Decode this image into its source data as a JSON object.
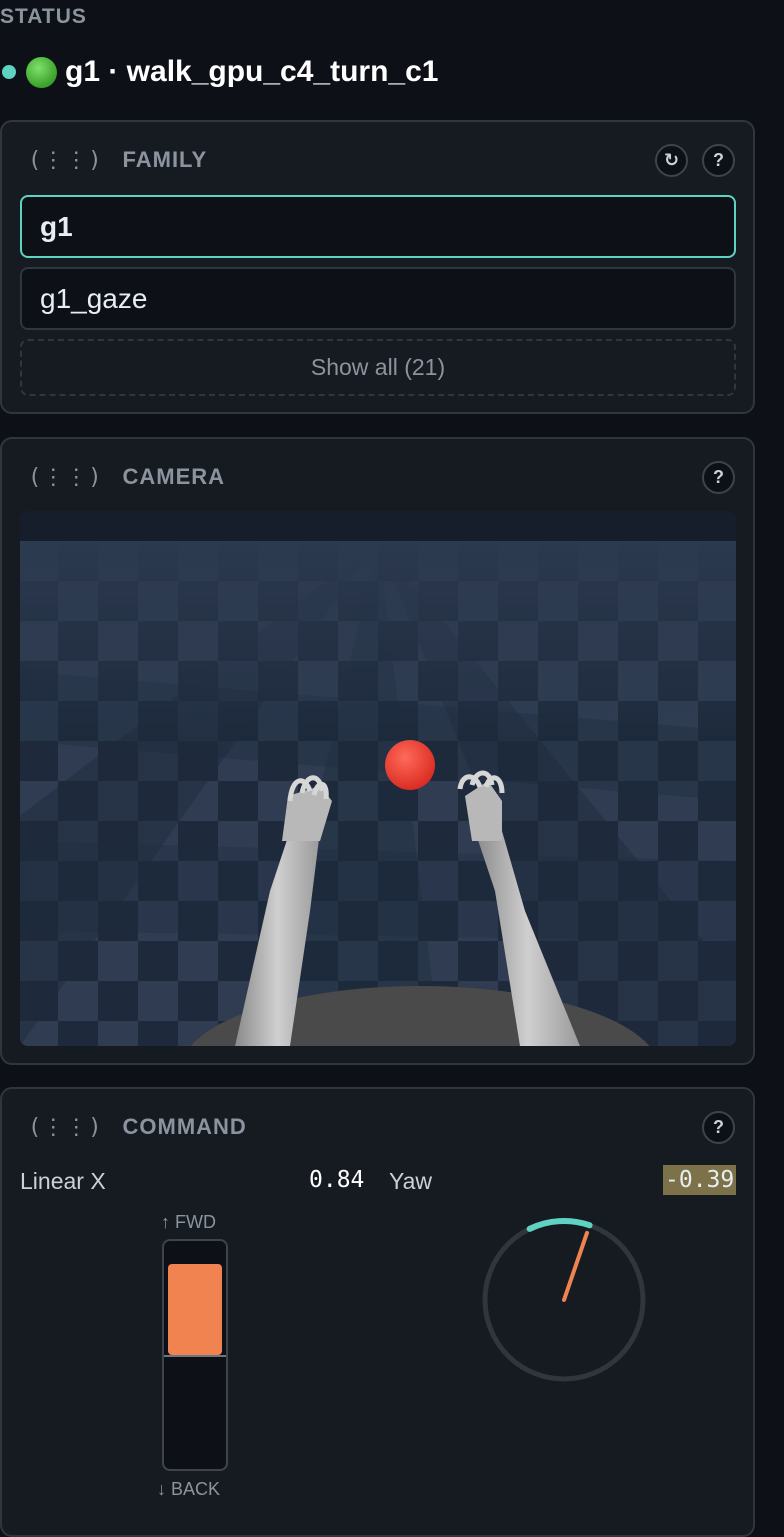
{
  "status": {
    "title": "STATUS",
    "text": "g1 · walk_gpu_c4_turn_c1",
    "dot_color": "#5ed3c2"
  },
  "family": {
    "title": "FAMILY",
    "handle": "(⋮⋮)",
    "refresh_icon": "↻",
    "help_icon": "?",
    "items": [
      {
        "label": "g1",
        "selected": true
      },
      {
        "label": "g1_gaze",
        "selected": false
      }
    ],
    "show_all_label": "Show all (21)"
  },
  "camera": {
    "title": "CAMERA",
    "handle": "(⋮⋮)",
    "help_icon": "?"
  },
  "command": {
    "title": "COMMAND",
    "handle": "(⋮⋮)",
    "help_icon": "?",
    "linear_x_label": "Linear X",
    "linear_x_value": "0.84",
    "linear_x_fraction": 0.84,
    "yaw_label": "Yaw",
    "yaw_value": "-0.39",
    "fwd_label": "↑ FWD",
    "back_label": "↓ BACK",
    "accent_color": "#f0834f",
    "yaw_color": "#5ed3c2"
  }
}
